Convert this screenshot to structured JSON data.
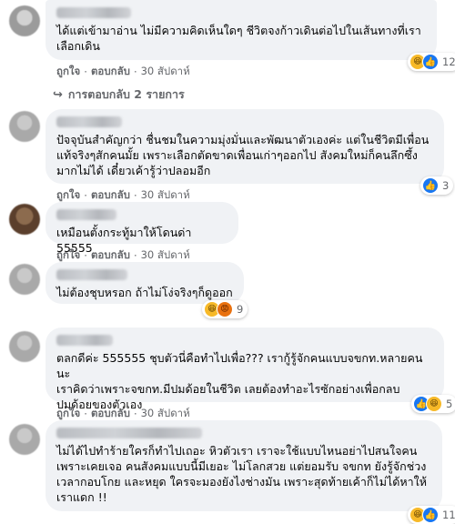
{
  "colors": {
    "bubble": "#f0f2f5",
    "meta": "#65676b",
    "like": "#1877f2",
    "haha": "#f7b928",
    "angry": "#e9710f"
  },
  "actions": {
    "like": "ถูกใจ",
    "reply": "ตอบกลับ",
    "sep": "·"
  },
  "view_replies": "การตอบกลับ 2 รายการ",
  "comments": [
    {
      "text": "ได้แต่เข้ามาอ่าน ไม่มีความคิดเห็นใดๆ ชีวิตจงก้าวเดินต่อไปในเส้นทางที่เรา\nเลือกเดิน",
      "time": "30 สัปดาห์",
      "reactions": [
        "haha",
        "like"
      ],
      "count": "12"
    },
    {
      "text": "ปัจจุบันสำคัญกว่า ชื่นชมในความมุ่งมั่นและพัฒนาตัวเองค่ะ แต่ในชีวิตมีเพื่อน\nแท้จริงๆสักคนมั้ย เพราะเลือกตัดขาดเพื่อนเก่าๆออกไป สังคมใหม่ก็คนลึกซึ้ง\nมากไม่ได้ เดี๋ยวเค้ารู้ว่าปลอมอีก",
      "time": "30 สัปดาห์",
      "reactions": [
        "like"
      ],
      "count": "3"
    },
    {
      "text": "เหมือนตั้งกระทู้มาให้โดนด่า 55555",
      "time": "30 สัปดาห์",
      "reactions": [],
      "count": ""
    },
    {
      "text": "ไม่ต้องชุบหรอก ถ้าไม่โง่จริงๆก็ดูออก",
      "time": "30 สัปดาห์",
      "reactions": [
        "haha",
        "angry"
      ],
      "count": "9"
    },
    {
      "text": "ตลกดีค่ะ 555555 ชุบตัวนี่คือทำไปเพื่อ??? เรากู้รู้จักคนแบบจขกท.หลายคนนะ\nเราคิดว่าเพราะจขกท.มีปมด้อยในชีวิต เลยต้องทำอะไรซักอย่างเพื่อกลบ\nปมด้อยของตัวเอง",
      "time": "30 สัปดาห์",
      "reactions": [
        "like",
        "haha"
      ],
      "count": "5"
    },
    {
      "text": "ไม่ได้ไปทำร้ายใครก็ทำไปเถอะ หิวตัวเรา เราจะใช้แบบไหนอย่าไปสนใจคน\nเพราะเคยเจอ คนสังคมแบบนี้มีเยอะ ไม่โลกสวย แต่ยอมรับ จขกท ยังรู้จักช่วง\nเวลากอบโกย และหยุด ใครจะมองยังไงช่างมัน เพราะสุดท้ายเค้าก็ไม่ได้หาให้\nเราแดก !!",
      "time": "",
      "reactions": [
        "haha",
        "like"
      ],
      "count": "11"
    }
  ]
}
